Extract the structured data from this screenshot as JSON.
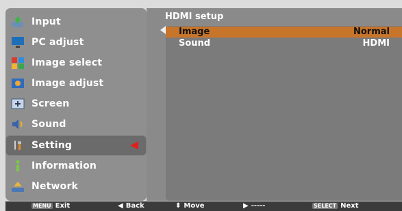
{
  "menu": {
    "items": [
      {
        "label": "Input",
        "icon": "input-icon"
      },
      {
        "label": "PC adjust",
        "icon": "pc-adjust-icon"
      },
      {
        "label": "Image select",
        "icon": "image-select-icon"
      },
      {
        "label": "Image adjust",
        "icon": "image-adjust-icon"
      },
      {
        "label": "Screen",
        "icon": "screen-icon"
      },
      {
        "label": "Sound",
        "icon": "sound-icon"
      },
      {
        "label": "Setting",
        "icon": "setting-icon",
        "selected": true
      },
      {
        "label": "Information",
        "icon": "information-icon"
      },
      {
        "label": "Network",
        "icon": "network-icon"
      }
    ]
  },
  "panel": {
    "title": "HDMI setup",
    "rows": [
      {
        "label": "Image",
        "value": "Normal",
        "selected": true
      },
      {
        "label": "Sound",
        "value": "HDMI"
      }
    ]
  },
  "bottom": {
    "exit": {
      "chip": "MENU",
      "label": "Exit"
    },
    "back": {
      "icon": "◀",
      "label": "Back"
    },
    "move": {
      "icon": "⬍",
      "label": "Move"
    },
    "right": {
      "icon": "▶",
      "label": "-----"
    },
    "next": {
      "chip": "SELECT",
      "label": "Next"
    }
  },
  "colors": {
    "menu_bg": "#8f8f8f",
    "panel_bg": "#7b7b7b",
    "selected_row": "#c7752b",
    "pointer": "#e0201e",
    "bottom_bar": "#3b3b3b"
  }
}
